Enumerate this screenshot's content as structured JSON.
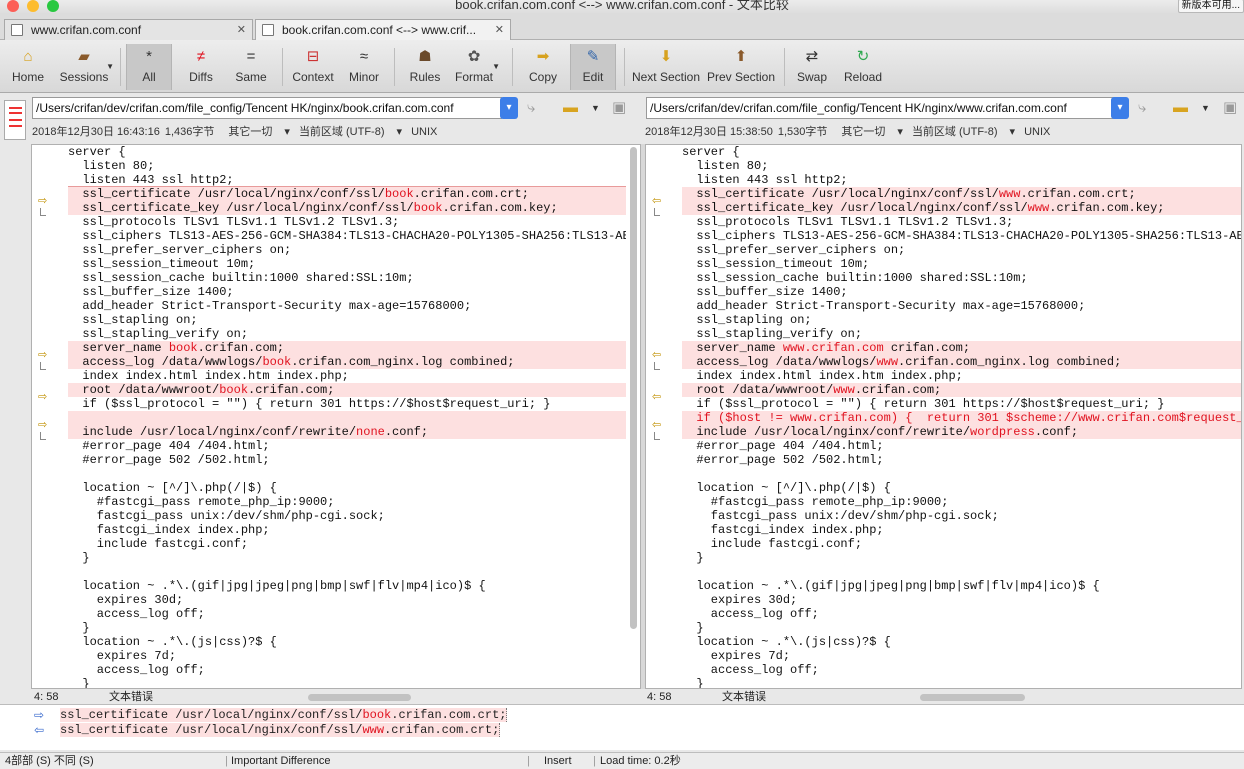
{
  "window": {
    "title": "book.crifan.com.conf <--> www.crifan.com.conf - 文本比较",
    "update_button": "新版本可用..."
  },
  "tabs": [
    {
      "label": "www.crifan.com.conf",
      "close": "✕"
    },
    {
      "label": "book.crifan.com.conf <--> www.crif...",
      "close": "✕"
    }
  ],
  "toolbar": [
    {
      "label": "Home",
      "icon": "home-icon"
    },
    {
      "label": "Sessions",
      "icon": "briefcase-icon"
    },
    {
      "label": "All",
      "icon": "asterisk-icon"
    },
    {
      "label": "Diffs",
      "icon": "not-equal-icon"
    },
    {
      "label": "Same",
      "icon": "equal-icon"
    },
    {
      "label": "Context",
      "icon": "context-icon"
    },
    {
      "label": "Minor",
      "icon": "approx-icon"
    },
    {
      "label": "Rules",
      "icon": "person-icon"
    },
    {
      "label": "Format",
      "icon": "palette-icon"
    },
    {
      "label": "Copy",
      "icon": "arrow-right-icon"
    },
    {
      "label": "Edit",
      "icon": "edit-icon"
    },
    {
      "label": "Next Section",
      "icon": "arrow-down-icon"
    },
    {
      "label": "Prev Section",
      "icon": "arrow-up-icon"
    },
    {
      "label": "Swap",
      "icon": "swap-icon"
    },
    {
      "label": "Reload",
      "icon": "reload-icon"
    }
  ],
  "left": {
    "path": "/Users/crifan/dev/crifan.com/file_config/Tencent HK/nginx/book.crifan.com.conf",
    "date": "2018年12月30日 16:43:16",
    "size": "1,436字节",
    "other": "其它一切",
    "encoding": "当前区域 (UTF-8)",
    "lineend": "UNIX",
    "cursor": "4: 58",
    "mode": "文本错误"
  },
  "right": {
    "path": "/Users/crifan/dev/crifan.com/file_config/Tencent HK/nginx/www.crifan.com.conf",
    "date": "2018年12月30日 15:38:50",
    "size": "1,530字节",
    "other": "其它一切",
    "encoding": "当前区域 (UTF-8)",
    "lineend": "UNIX",
    "cursor": "4: 58",
    "mode": "文本错误"
  },
  "left_lines": [
    [
      [
        "server {",
        0
      ]
    ],
    [
      [
        "  listen 80;",
        0
      ]
    ],
    [
      [
        "  listen 443 ssl http2;",
        0
      ]
    ],
    [
      [
        "  ssl_certificate /usr/local/nginx/conf/ssl/",
        0
      ],
      [
        "book",
        1
      ],
      [
        ".crifan.com.crt;",
        0
      ]
    ],
    [
      [
        "  ssl_certificate_key /usr/local/nginx/conf/ssl/",
        0
      ],
      [
        "book",
        1
      ],
      [
        ".crifan.com.key;",
        0
      ]
    ],
    [
      [
        "  ssl_protocols TLSv1 TLSv1.1 TLSv1.2 TLSv1.3;",
        0
      ]
    ],
    [
      [
        "  ssl_ciphers TLS13-AES-256-GCM-SHA384:TLS13-CHACHA20-POLY1305-SHA256:TLS13-AES-",
        0
      ]
    ],
    [
      [
        "  ssl_prefer_server_ciphers on;",
        0
      ]
    ],
    [
      [
        "  ssl_session_timeout 10m;",
        0
      ]
    ],
    [
      [
        "  ssl_session_cache builtin:1000 shared:SSL:10m;",
        0
      ]
    ],
    [
      [
        "  ssl_buffer_size 1400;",
        0
      ]
    ],
    [
      [
        "  add_header Strict-Transport-Security max-age=15768000;",
        0
      ]
    ],
    [
      [
        "  ssl_stapling on;",
        0
      ]
    ],
    [
      [
        "  ssl_stapling_verify on;",
        0
      ]
    ],
    [
      [
        "  server_name ",
        0
      ],
      [
        "book",
        1
      ],
      [
        ".crifan.com;",
        0
      ]
    ],
    [
      [
        "  access_log /data/wwwlogs/",
        0
      ],
      [
        "book",
        1
      ],
      [
        ".crifan.com_nginx.log combined;",
        0
      ]
    ],
    [
      [
        "  index index.html index.htm index.php;",
        0
      ]
    ],
    [
      [
        "  root /data/wwwroot/",
        0
      ],
      [
        "book",
        1
      ],
      [
        ".crifan.com;",
        0
      ]
    ],
    [
      [
        "  if ($ssl_protocol = \"\") { return 301 https://$host$request_uri; }",
        0
      ]
    ],
    [
      [
        "",
        0
      ]
    ],
    [
      [
        "  include /usr/local/nginx/conf/rewrite/",
        0
      ],
      [
        "none",
        1
      ],
      [
        ".conf;",
        0
      ]
    ],
    [
      [
        "  #error_page 404 /404.html;",
        0
      ]
    ],
    [
      [
        "  #error_page 502 /502.html;",
        0
      ]
    ],
    [
      [
        "",
        0
      ]
    ],
    [
      [
        "  location ~ [^/]\\.php(/|$) {",
        0
      ]
    ],
    [
      [
        "    #fastcgi_pass remote_php_ip:9000;",
        0
      ]
    ],
    [
      [
        "    fastcgi_pass unix:/dev/shm/php-cgi.sock;",
        0
      ]
    ],
    [
      [
        "    fastcgi_index index.php;",
        0
      ]
    ],
    [
      [
        "    include fastcgi.conf;",
        0
      ]
    ],
    [
      [
        "  }",
        0
      ]
    ],
    [
      [
        "",
        0
      ]
    ],
    [
      [
        "  location ~ .*\\.(gif|jpg|jpeg|png|bmp|swf|flv|mp4|ico)$ {",
        0
      ]
    ],
    [
      [
        "    expires 30d;",
        0
      ]
    ],
    [
      [
        "    access_log off;",
        0
      ]
    ],
    [
      [
        "  }",
        0
      ]
    ],
    [
      [
        "  location ~ .*\\.(js|css)?$ {",
        0
      ]
    ],
    [
      [
        "    expires 7d;",
        0
      ]
    ],
    [
      [
        "    access_log off;",
        0
      ]
    ],
    [
      [
        "  }",
        0
      ]
    ]
  ],
  "right_lines": [
    [
      [
        "server {",
        0
      ]
    ],
    [
      [
        "  listen 80;",
        0
      ]
    ],
    [
      [
        "  listen 443 ssl http2;",
        0
      ]
    ],
    [
      [
        "  ssl_certificate /usr/local/nginx/conf/ssl/",
        0
      ],
      [
        "www",
        1
      ],
      [
        ".crifan.com.crt;",
        0
      ]
    ],
    [
      [
        "  ssl_certificate_key /usr/local/nginx/conf/ssl/",
        0
      ],
      [
        "www",
        1
      ],
      [
        ".crifan.com.key;",
        0
      ]
    ],
    [
      [
        "  ssl_protocols TLSv1 TLSv1.1 TLSv1.2 TLSv1.3;",
        0
      ]
    ],
    [
      [
        "  ssl_ciphers TLS13-AES-256-GCM-SHA384:TLS13-CHACHA20-POLY1305-SHA256:TLS13-AES",
        0
      ]
    ],
    [
      [
        "  ssl_prefer_server_ciphers on;",
        0
      ]
    ],
    [
      [
        "  ssl_session_timeout 10m;",
        0
      ]
    ],
    [
      [
        "  ssl_session_cache builtin:1000 shared:SSL:10m;",
        0
      ]
    ],
    [
      [
        "  ssl_buffer_size 1400;",
        0
      ]
    ],
    [
      [
        "  add_header Strict-Transport-Security max-age=15768000;",
        0
      ]
    ],
    [
      [
        "  ssl_stapling on;",
        0
      ]
    ],
    [
      [
        "  ssl_stapling_verify on;",
        0
      ]
    ],
    [
      [
        "  server_name ",
        0
      ],
      [
        "www.crifan.com",
        1
      ],
      [
        " crifan.com;",
        0
      ]
    ],
    [
      [
        "  access_log /data/wwwlogs/",
        0
      ],
      [
        "www",
        1
      ],
      [
        ".crifan.com_nginx.log combined;",
        0
      ]
    ],
    [
      [
        "  index index.html index.htm index.php;",
        0
      ]
    ],
    [
      [
        "  root /data/wwwroot/",
        0
      ],
      [
        "www",
        1
      ],
      [
        ".crifan.com;",
        0
      ]
    ],
    [
      [
        "  if ($ssl_protocol = \"\") { return 301 https://$host$request_uri; }",
        0
      ]
    ],
    [
      [
        "  if ($host != www.crifan.com) {  return 301 $scheme://www.crifan.com$request_u",
        1
      ]
    ],
    [
      [
        "  include /usr/local/nginx/conf/rewrite/",
        0
      ],
      [
        "wordpress",
        1
      ],
      [
        ".conf;",
        0
      ]
    ],
    [
      [
        "  #error_page 404 /404.html;",
        0
      ]
    ],
    [
      [
        "  #error_page 502 /502.html;",
        0
      ]
    ],
    [
      [
        "",
        0
      ]
    ],
    [
      [
        "  location ~ [^/]\\.php(/|$) {",
        0
      ]
    ],
    [
      [
        "    #fastcgi_pass remote_php_ip:9000;",
        0
      ]
    ],
    [
      [
        "    fastcgi_pass unix:/dev/shm/php-cgi.sock;",
        0
      ]
    ],
    [
      [
        "    fastcgi_index index.php;",
        0
      ]
    ],
    [
      [
        "    include fastcgi.conf;",
        0
      ]
    ],
    [
      [
        "  }",
        0
      ]
    ],
    [
      [
        "",
        0
      ]
    ],
    [
      [
        "  location ~ .*\\.(gif|jpg|jpeg|png|bmp|swf|flv|mp4|ico)$ {",
        0
      ]
    ],
    [
      [
        "    expires 30d;",
        0
      ]
    ],
    [
      [
        "    access_log off;",
        0
      ]
    ],
    [
      [
        "  }",
        0
      ]
    ],
    [
      [
        "  location ~ .*\\.(js|css)?$ {",
        0
      ]
    ],
    [
      [
        "    expires 7d;",
        0
      ]
    ],
    [
      [
        "    access_log off;",
        0
      ]
    ],
    [
      [
        "  }",
        0
      ]
    ]
  ],
  "diff_lines": [
    3,
    4,
    14,
    15,
    17,
    19,
    20
  ],
  "gutter_arrows": [
    3,
    14,
    17,
    19
  ],
  "compare": {
    "left": [
      [
        "ssl_certificate /usr/local/nginx/conf/ssl/",
        0
      ],
      [
        "book",
        1
      ],
      [
        ".crifan.com.crt;",
        0
      ]
    ],
    "right": [
      [
        "ssl_certificate /usr/local/nginx/conf/ssl/",
        0
      ],
      [
        "www",
        1
      ],
      [
        ".crifan.com.crt;",
        0
      ]
    ]
  },
  "status": {
    "sections": "4部部 (S) 不同 (S)",
    "importance": "Important Difference",
    "mode": "Insert",
    "load": "Load time: 0.2秒"
  },
  "colors": {
    "diff_bg": "#fde0e0",
    "diff_text": "#e0121f",
    "accent": "#3c7ee8"
  }
}
